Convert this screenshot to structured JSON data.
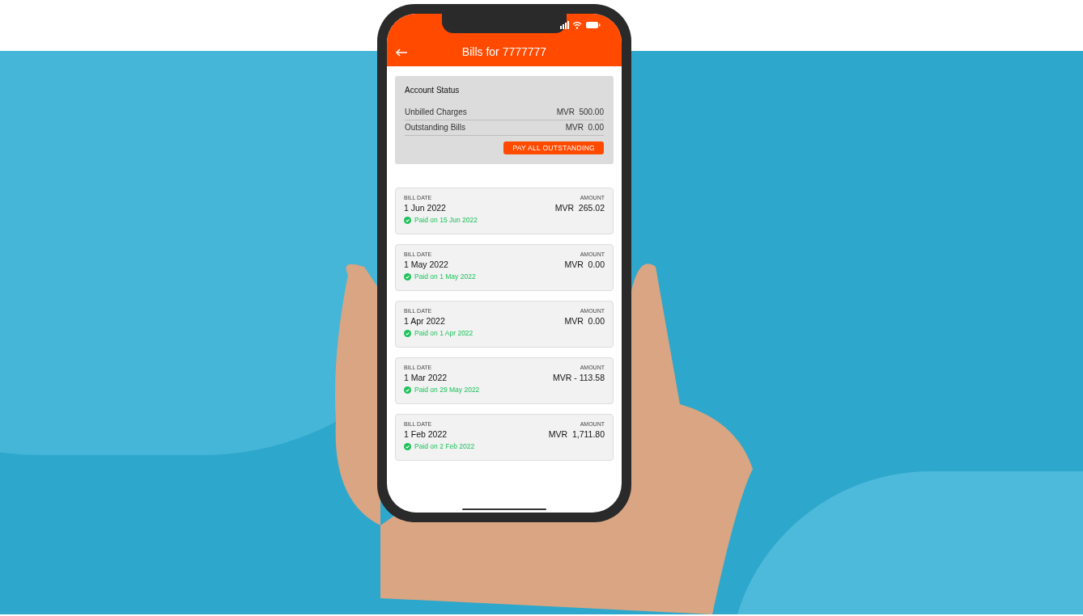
{
  "header": {
    "title": "Bills for 7777777"
  },
  "account_status": {
    "title": "Account Status",
    "rows": [
      {
        "label": "Unbilled Charges",
        "value": "MVR  500.00"
      },
      {
        "label": "Outstanding Bills",
        "value": "MVR  0.00"
      }
    ],
    "button": "PAY ALL OUTSTANDING"
  },
  "bills": [
    {
      "date_label": "BILL DATE",
      "date": "1 Jun 2022",
      "amount_label": "AMOUNT",
      "amount": "MVR  265.02",
      "status": "Paid on 15 Jun 2022",
      "paid": true
    },
    {
      "date_label": "BILL DATE",
      "date": "1 May 2022",
      "amount_label": "AMOUNT",
      "amount": "MVR  0.00",
      "status": "Paid on 1 May 2022",
      "paid": true
    },
    {
      "date_label": "BILL DATE",
      "date": "1 Apr 2022",
      "amount_label": "AMOUNT",
      "amount": "MVR  0.00",
      "status": "Paid on 1 Apr 2022",
      "paid": true
    },
    {
      "date_label": "BILL DATE",
      "date": "1 Mar 2022",
      "amount_label": "AMOUNT",
      "amount": "MVR - 113.58",
      "status": "Paid on 29 May 2022",
      "paid": true
    },
    {
      "date_label": "BILL DATE",
      "date": "1 Feb 2022",
      "amount_label": "AMOUNT",
      "amount": "MVR  1,711.80",
      "status": "Paid on 2 Feb 2022",
      "paid": true
    }
  ]
}
